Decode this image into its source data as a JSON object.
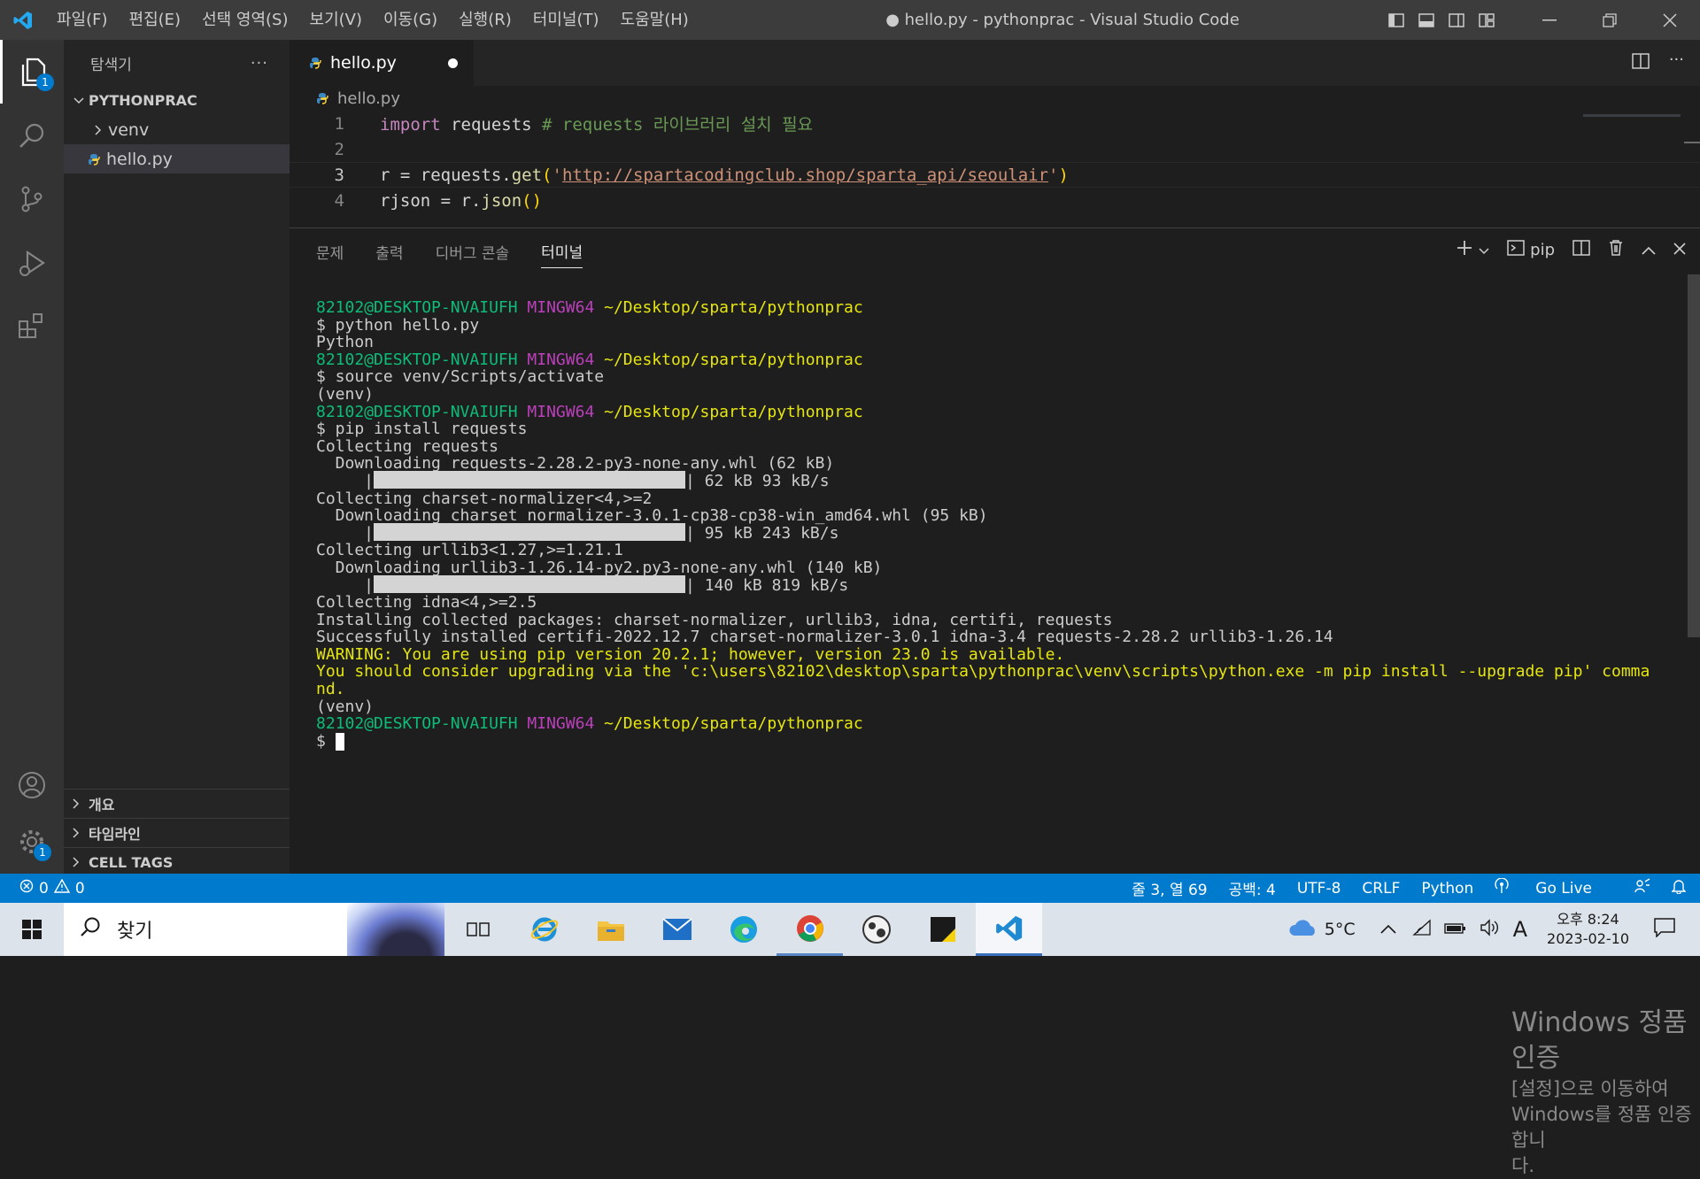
{
  "window": {
    "title": "● hello.py - pythonprac - Visual Studio Code"
  },
  "menu": [
    "파일(F)",
    "편집(E)",
    "선택 영역(S)",
    "보기(V)",
    "이동(G)",
    "실행(R)",
    "터미널(T)",
    "도움말(H)"
  ],
  "activity": {
    "explorer_badge": "1",
    "settings_badge": "1"
  },
  "sidebar": {
    "title": "탐색기",
    "more": "···",
    "project": "PYTHONPRAC",
    "items": [
      {
        "label": "venv"
      },
      {
        "label": "hello.py"
      }
    ],
    "sections": [
      "개요",
      "타임라인",
      "CELL TAGS"
    ]
  },
  "editor": {
    "tab": "hello.py",
    "breadcrumb": "hello.py",
    "lines": [
      {
        "n": "1",
        "parts": [
          {
            "t": "import",
            "c": "#c586c0"
          },
          {
            "t": " requests ",
            "c": "#d4d4d4"
          },
          {
            "t": "# requests 라이브러리 설치 필요",
            "c": "#6a9955"
          }
        ]
      },
      {
        "n": "2",
        "parts": []
      },
      {
        "n": "3",
        "parts": [
          {
            "t": "r = requests.",
            "c": "#d4d4d4"
          },
          {
            "t": "get",
            "c": "#dcdcaa"
          },
          {
            "t": "(",
            "c": "#ffd700"
          },
          {
            "t": "'",
            "c": "#ce9178"
          },
          {
            "t": "http://spartacodingclub.shop/sparta_api/seoulair",
            "c": "#ce9178",
            "u": true
          },
          {
            "t": "'",
            "c": "#ce9178"
          },
          {
            "t": ")",
            "c": "#ffd700"
          }
        ]
      },
      {
        "n": "4",
        "parts": [
          {
            "t": "rjson = r.",
            "c": "#d4d4d4"
          },
          {
            "t": "json",
            "c": "#dcdcaa"
          },
          {
            "t": "()",
            "c": "#ffd700"
          }
        ]
      }
    ]
  },
  "panel": {
    "tabs": [
      "문제",
      "출력",
      "디버그 콘솔",
      "터미널"
    ],
    "active_tab": "터미널",
    "shell": "pip",
    "terminal": [
      [
        {
          "t": "82102@DESKTOP-NVAIUFH ",
          "c": "g"
        },
        {
          "t": "MINGW64 ",
          "c": "m"
        },
        {
          "t": "~/Desktop/sparta/pythonprac",
          "c": "y"
        }
      ],
      [
        {
          "t": "$ python hello.py",
          "c": "w"
        }
      ],
      [
        {
          "t": "Python",
          "c": "w"
        }
      ],
      [
        {
          "t": "82102@DESKTOP-NVAIUFH ",
          "c": "g"
        },
        {
          "t": "MINGW64 ",
          "c": "m"
        },
        {
          "t": "~/Desktop/sparta/pythonprac",
          "c": "y"
        }
      ],
      [
        {
          "t": "$ source venv/Scripts/activate",
          "c": "w"
        }
      ],
      [
        {
          "t": "(venv)",
          "c": "w"
        }
      ],
      [
        {
          "t": "82102@DESKTOP-NVAIUFH ",
          "c": "g"
        },
        {
          "t": "MINGW64 ",
          "c": "m"
        },
        {
          "t": "~/Desktop/sparta/pythonprac",
          "c": "y"
        }
      ],
      [
        {
          "t": "$ pip install requests",
          "c": "w"
        }
      ],
      [
        {
          "t": "Collecting requests",
          "c": "w"
        }
      ],
      [
        {
          "t": "  Downloading requests-2.28.2-py3-none-any.whl (62 kB)",
          "c": "w"
        }
      ],
      [
        {
          "t": "     |",
          "c": "w"
        },
        {
          "bar": true
        },
        {
          "t": "| 62 kB 93 kB/s",
          "c": "w"
        }
      ],
      [
        {
          "t": "Collecting charset-normalizer<4,>=2",
          "c": "w"
        }
      ],
      [
        {
          "t": "  Downloading charset_normalizer-3.0.1-cp38-cp38-win_amd64.whl (95 kB)",
          "c": "w"
        }
      ],
      [
        {
          "t": "     |",
          "c": "w"
        },
        {
          "bar": true
        },
        {
          "t": "| 95 kB 243 kB/s",
          "c": "w"
        }
      ],
      [
        {
          "t": "Collecting urllib3<1.27,>=1.21.1",
          "c": "w"
        }
      ],
      [
        {
          "t": "  Downloading urllib3-1.26.14-py2.py3-none-any.whl (140 kB)",
          "c": "w"
        }
      ],
      [
        {
          "t": "     |",
          "c": "w"
        },
        {
          "bar": true
        },
        {
          "t": "| 140 kB 819 kB/s",
          "c": "w"
        }
      ],
      [
        {
          "t": "Collecting idna<4,>=2.5",
          "c": "w"
        }
      ],
      [
        {
          "t": "Installing collected packages: charset-normalizer, urllib3, idna, certifi, requests",
          "c": "w"
        }
      ],
      [
        {
          "t": "Successfully installed certifi-2022.12.7 charset-normalizer-3.0.1 idna-3.4 requests-2.28.2 urllib3-1.26.14",
          "c": "w"
        }
      ],
      [
        {
          "t": "WARNING: You are using pip version 20.2.1; however, version 23.0 is available.",
          "c": "y"
        }
      ],
      [
        {
          "t": "You should consider upgrading via the 'c:\\users\\82102\\desktop\\sparta\\pythonprac\\venv\\scripts\\python.exe -m pip install --upgrade pip' comma",
          "c": "y"
        }
      ],
      [
        {
          "t": "nd.",
          "c": "y"
        }
      ],
      [
        {
          "t": "(venv)",
          "c": "w"
        }
      ],
      [
        {
          "t": "82102@DESKTOP-NVAIUFH ",
          "c": "g"
        },
        {
          "t": "MINGW64 ",
          "c": "m"
        },
        {
          "t": "~/Desktop/sparta/pythonprac",
          "c": "y"
        }
      ],
      [
        {
          "t": "$ ",
          "c": "w"
        },
        {
          "cursor": true
        }
      ]
    ]
  },
  "watermark": {
    "title": "Windows 정품 인증",
    "line1": "[설정]으로 이동하여 Windows를 정품 인증합니",
    "line2": "다."
  },
  "status": {
    "errors": "0",
    "warnings": "0",
    "position": "줄 3, 열 69",
    "spaces": "공백: 4",
    "encoding": "UTF-8",
    "eol": "CRLF",
    "language": "Python",
    "golive": "Go Live"
  },
  "taskbar": {
    "search": "찾기",
    "weather": "5°C",
    "time": "오후 8:24",
    "date": "2023-02-10",
    "ime": "A"
  }
}
